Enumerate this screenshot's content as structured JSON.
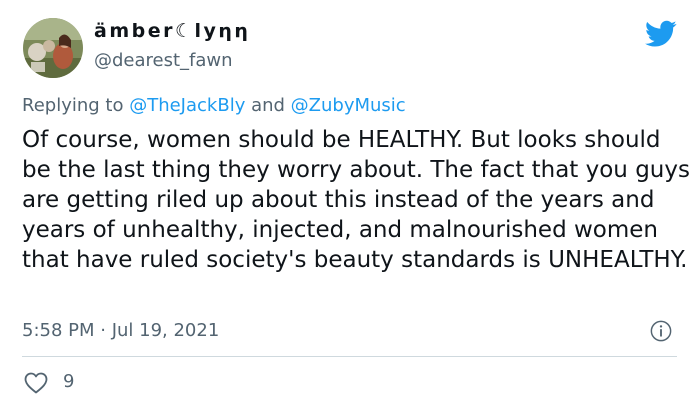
{
  "tweet": {
    "display_name": "ämber☾lyηη",
    "handle": "@dearest_fawn",
    "reply_prefix": "Replying to ",
    "reply_mention_1": "@TheJackBly",
    "reply_and": " and ",
    "reply_mention_2": "@ZubyMusic",
    "body": "Of course, women should be HEALTHY. But looks should be the last thing they worry about. The fact that you guys are getting riled up about this instead of the years and years of unhealthy, injected, and malnourished women that have ruled society's beauty standards is UNHEALTHY.",
    "timestamp": "5:58 PM · Jul 19, 2021",
    "like_count": "9"
  },
  "icons": {
    "logo": "twitter-bird-icon",
    "info": "info-icon",
    "like": "heart-icon"
  },
  "colors": {
    "accent": "#1d9bf0",
    "secondary_text": "#536471",
    "divider": "#cfd9de"
  }
}
